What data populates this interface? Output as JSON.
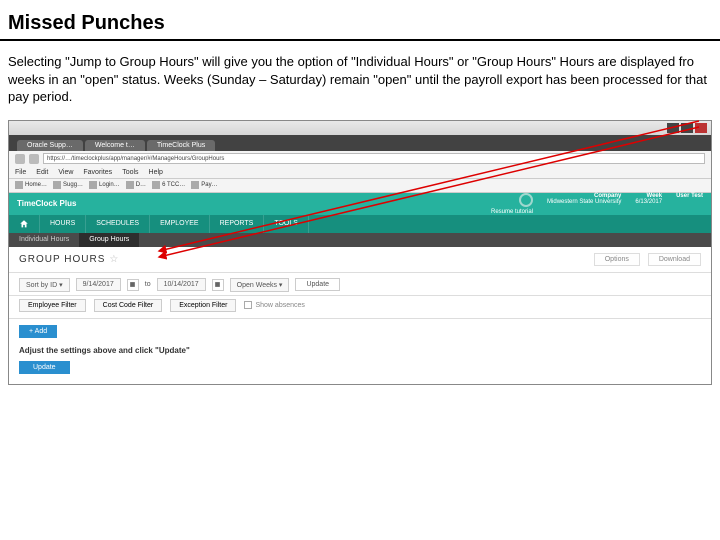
{
  "doc": {
    "title": "Missed Punches",
    "body": "Selecting \"Jump to Group Hours\" will give you the option of \"Individual Hours\" or \"Group Hours\"  Hours are displayed fro weeks in an \"open\" status.  Weeks (Sunday – Saturday) remain \"open\" until the payroll export has been processed for that pay period."
  },
  "browser": {
    "tabs": [
      "Oracle Supp…",
      "Welcome t…",
      "TimeClock Plus"
    ],
    "address": "https://…/timeclockplus/app/manager/#/ManageHours/GroupHours",
    "menus": [
      "File",
      "Edit",
      "View",
      "Favorites",
      "Tools",
      "Help"
    ],
    "bookmarks": [
      "Home…",
      "Sugg…",
      "Login…",
      "D…",
      "6 TCC…",
      "Pay…"
    ]
  },
  "app": {
    "brand": "TimeClock Plus",
    "tutorial": "Resume tutorial",
    "company_label": "Company",
    "company": "Midwestern State University",
    "week_label": "Week",
    "week": "6/13/2017",
    "user": "User Test",
    "main_nav": [
      "HOURS",
      "SCHEDULES",
      "EMPLOYEE",
      "REPORTS",
      "TOOLS"
    ],
    "sub_nav": [
      "Individual Hours",
      "Group Hours"
    ],
    "page_title": "GROUP HOURS",
    "options": "Options",
    "download": "Download",
    "sort_label": "Sort by ID",
    "date_from": "9/14/2017",
    "date_to": "10/14/2017",
    "to": "to",
    "period": "Open Weeks",
    "update": "Update",
    "filters": {
      "emp": "Employee Filter",
      "cost": "Cost Code Filter",
      "exc": "Exception Filter"
    },
    "show_absences": "Show absences",
    "add": "+ Add",
    "prompt": "Adjust the settings above and click \"Update\""
  }
}
